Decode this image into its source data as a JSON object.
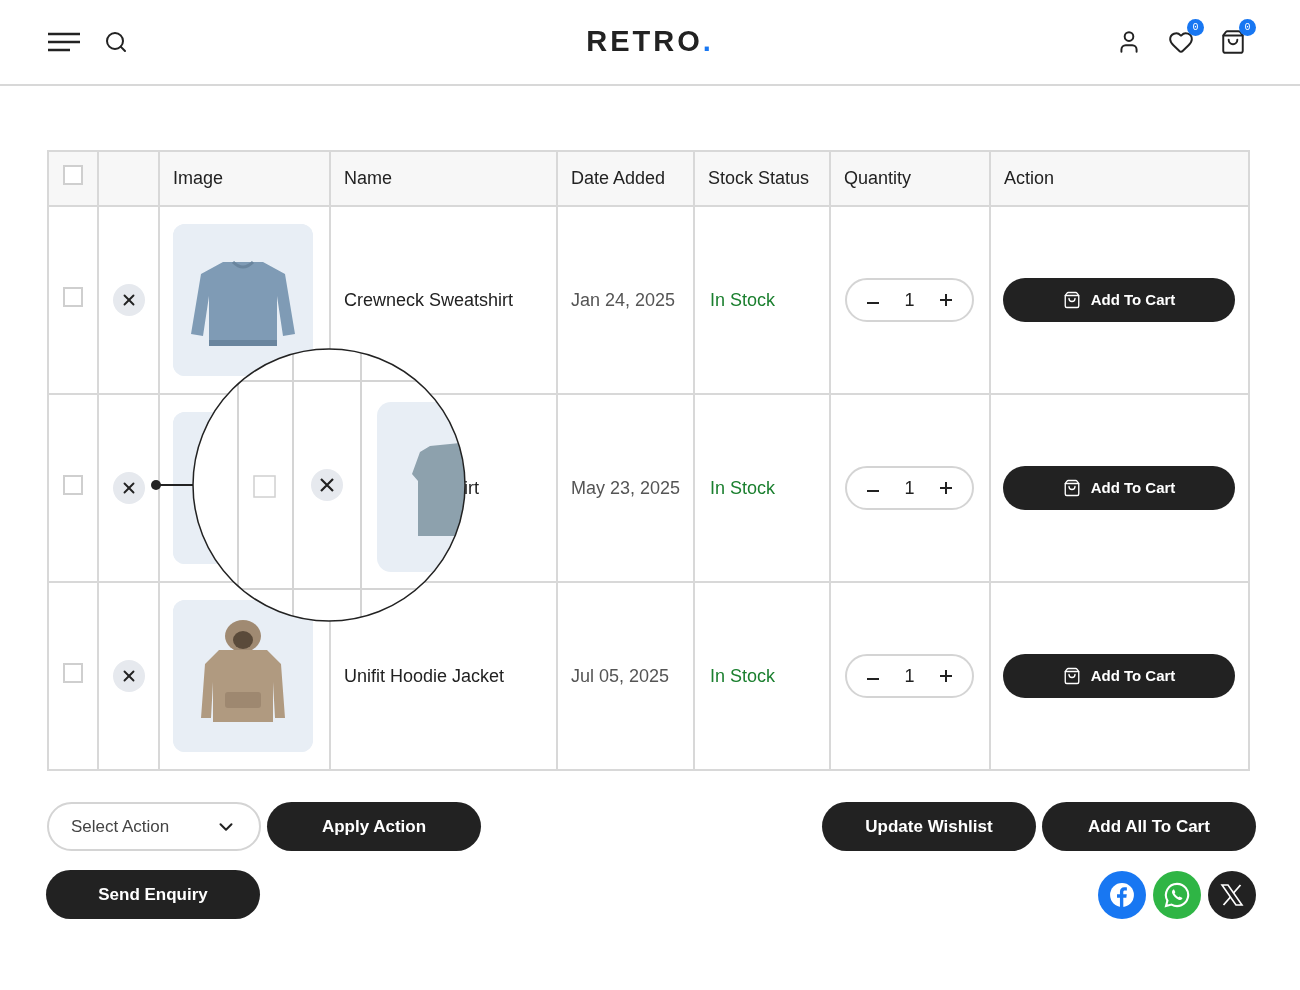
{
  "header": {
    "logo": {
      "text": "RETRO",
      "dot": "."
    },
    "wishlist_count": "0",
    "cart_count": "0"
  },
  "table": {
    "columns": [
      "Image",
      "Name",
      "Date Added",
      "Stock Status",
      "Quantity",
      "Action"
    ],
    "header_checkbox": {
      "checked": false
    },
    "rows": [
      {
        "checked": false,
        "name": "Crewneck Sweatshirt",
        "date": "Jan 24, 2025",
        "stock": "In Stock",
        "quantity": "1",
        "action": "Add To Cart",
        "covered": false
      },
      {
        "checked": false,
        "name": "irt",
        "date": "May 23, 2025",
        "stock": "In Stock",
        "quantity": "1",
        "action": "Add To Cart",
        "covered": true
      },
      {
        "checked": false,
        "name": "Unifit Hoodie Jacket",
        "date": "Jul 05, 2025",
        "stock": "In Stock",
        "quantity": "1",
        "action": "Add To Cart",
        "covered": false
      }
    ]
  },
  "actions": {
    "select": "Select Action",
    "apply": "Apply Action",
    "update": "Update Wishlist",
    "add_all": "Add All To Cart",
    "enquiry": "Send Enquiry"
  },
  "share": [
    {
      "kind": "facebook",
      "color": "#1877f2"
    },
    {
      "kind": "whatsapp",
      "color": "#2fb545"
    },
    {
      "kind": "x",
      "color": "#222222"
    }
  ]
}
